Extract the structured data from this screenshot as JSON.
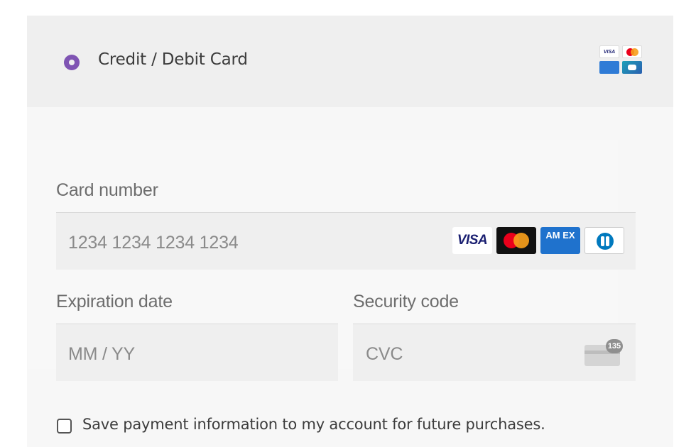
{
  "payment_method": {
    "label": "Credit / Debit Card",
    "selected": true,
    "accent_color": "#7f54b3",
    "icon_names": [
      "visa-icon",
      "mastercard-icon",
      "amex-icon",
      "cartes-bancaires-icon"
    ]
  },
  "card_form": {
    "card_number": {
      "label": "Card number",
      "placeholder": "1234 1234 1234 1234",
      "brand_icons": [
        "visa-icon",
        "mastercard-icon",
        "amex-icon",
        "diners-icon"
      ]
    },
    "expiry": {
      "label": "Expiration date",
      "placeholder": "MM / YY"
    },
    "security_code": {
      "label": "Security code",
      "placeholder": "CVC",
      "icon_badge": "135"
    },
    "brand_text": {
      "visa": "VISA",
      "mini_visa": "VISA",
      "amex": "AM EX"
    }
  },
  "save_payment": {
    "label": "Save payment information to my account for future purchases.",
    "checked": false
  }
}
